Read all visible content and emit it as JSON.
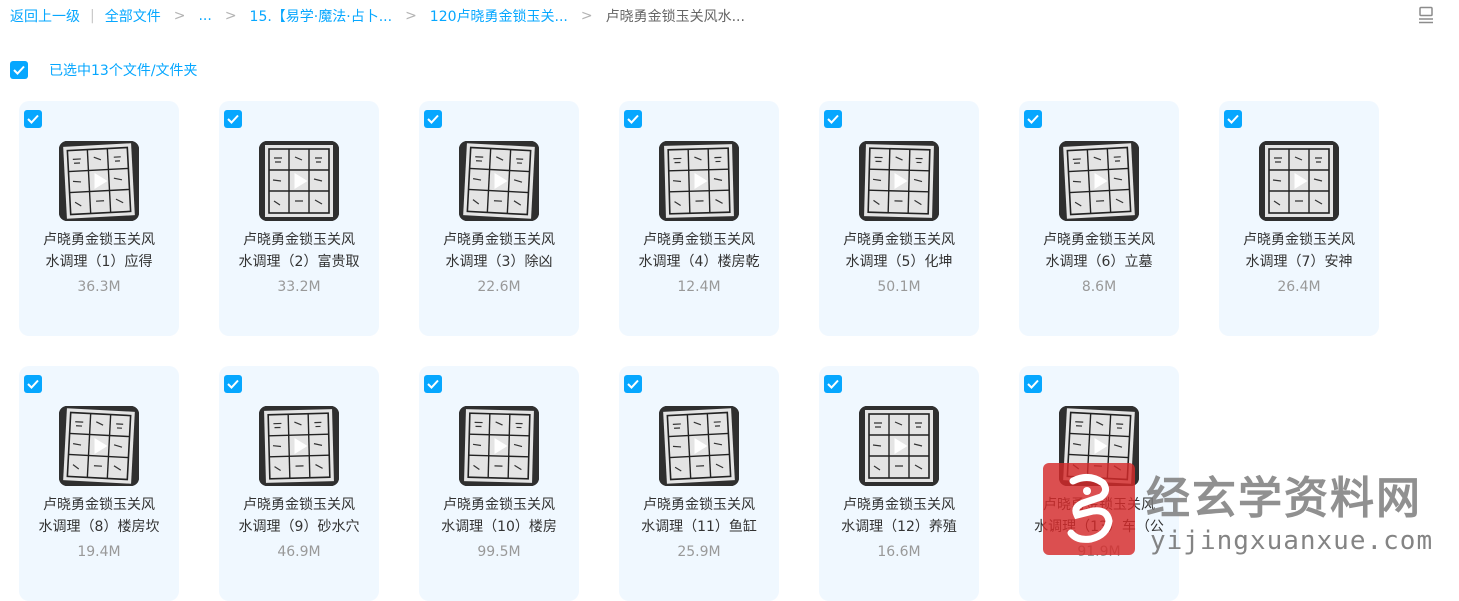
{
  "breadcrumb": {
    "back": "返回上一级",
    "all_files": "全部文件",
    "ellipsis": "...",
    "level1": "15.【易学·魔法·占卜...",
    "level2": "120卢晓勇金锁玉关...",
    "current": "卢晓勇金锁玉关风水..."
  },
  "selection": {
    "label": "已选中13个文件/文件夹"
  },
  "files": [
    {
      "line1": "卢晓勇金锁玉关风",
      "line2": "水调理（1）应得",
      "size": "36.3M"
    },
    {
      "line1": "卢晓勇金锁玉关风",
      "line2": "水调理（2）富贵取",
      "size": "33.2M"
    },
    {
      "line1": "卢晓勇金锁玉关风",
      "line2": "水调理（3）除凶",
      "size": "22.6M"
    },
    {
      "line1": "卢晓勇金锁玉关风",
      "line2": "水调理（4）楼房乾",
      "size": "12.4M"
    },
    {
      "line1": "卢晓勇金锁玉关风",
      "line2": "水调理（5）化坤",
      "size": "50.1M"
    },
    {
      "line1": "卢晓勇金锁玉关风",
      "line2": "水调理（6）立墓",
      "size": "8.6M"
    },
    {
      "line1": "卢晓勇金锁玉关风",
      "line2": "水调理（7）安神",
      "size": "26.4M"
    },
    {
      "line1": "卢晓勇金锁玉关风",
      "line2": "水调理（8）楼房坎",
      "size": "19.4M"
    },
    {
      "line1": "卢晓勇金锁玉关风",
      "line2": "水调理（9）砂水穴",
      "size": "46.9M"
    },
    {
      "line1": "卢晓勇金锁玉关风",
      "line2": "水调理（10）楼房",
      "size": "99.5M"
    },
    {
      "line1": "卢晓勇金锁玉关风",
      "line2": "水调理（11）鱼缸",
      "size": "25.9M"
    },
    {
      "line1": "卢晓勇金锁玉关风",
      "line2": "水调理（12）养殖",
      "size": "16.6M"
    },
    {
      "line1": "卢晓勇金锁玉关风",
      "line2": "水调理（13）车（公",
      "size": "91.9M"
    }
  ],
  "watermark": {
    "title": "经玄学资料网",
    "url": "yijingxuanxue.com"
  },
  "colors": {
    "accent": "#06a7ff",
    "card_bg": "#f0f8ff",
    "size_text": "#999999"
  },
  "icons": {
    "check": "checkmark-icon",
    "play": "play-icon",
    "view_toggle": "list-view-icon"
  }
}
